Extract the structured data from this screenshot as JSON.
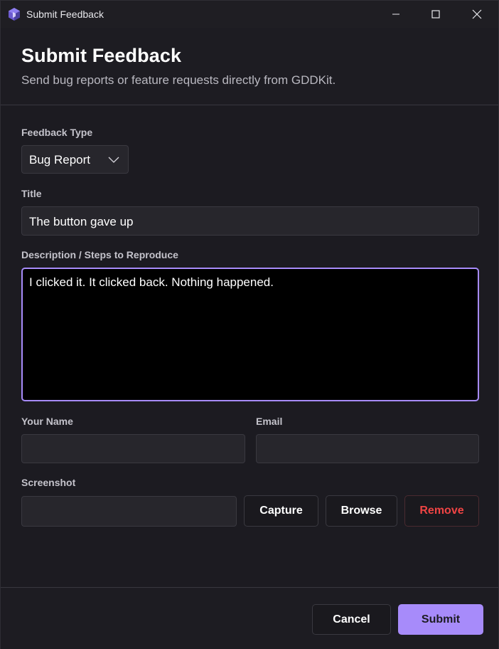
{
  "window": {
    "title": "Submit Feedback"
  },
  "header": {
    "title": "Submit Feedback",
    "subtitle": "Send bug reports or feature requests directly from GDDKit."
  },
  "form": {
    "feedback_type": {
      "label": "Feedback Type",
      "value": "Bug Report"
    },
    "title": {
      "label": "Title",
      "value": "The button gave up"
    },
    "description": {
      "label": "Description / Steps to Reproduce",
      "value": "I clicked it. It clicked back. Nothing happened."
    },
    "name": {
      "label": "Your Name",
      "value": ""
    },
    "email": {
      "label": "Email",
      "value": ""
    },
    "screenshot": {
      "label": "Screenshot",
      "value": "",
      "capture_label": "Capture",
      "browse_label": "Browse",
      "remove_label": "Remove"
    }
  },
  "footer": {
    "cancel_label": "Cancel",
    "submit_label": "Submit"
  },
  "colors": {
    "accent": "#a78bfa",
    "danger": "#ef4444",
    "background": "#1c1b21"
  }
}
